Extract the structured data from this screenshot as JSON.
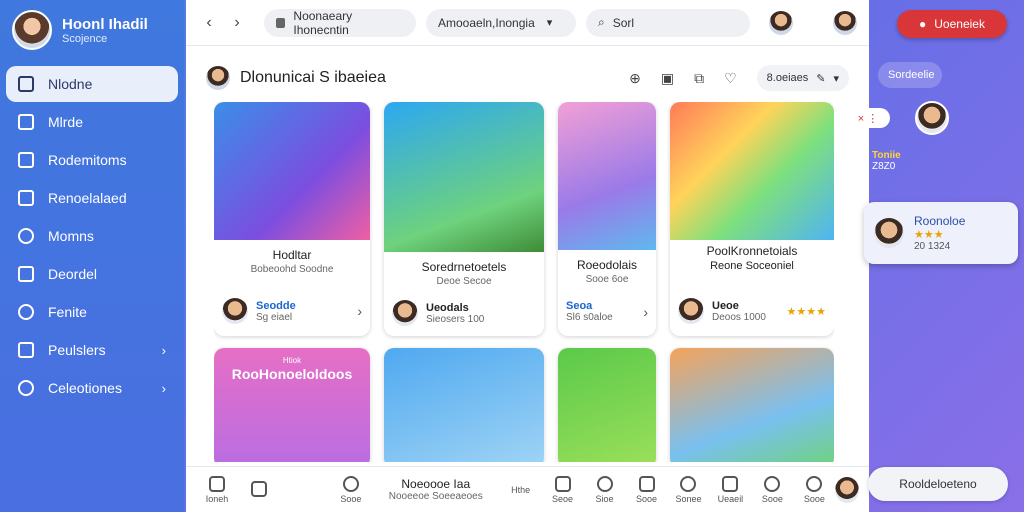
{
  "sidebar": {
    "profile": {
      "name": "Hoonl Ihadil",
      "subtitle": "Scojence"
    },
    "items": [
      {
        "label": "Nlodne",
        "icon": "square-icon",
        "active": true
      },
      {
        "label": "Mlrde",
        "icon": "list-icon"
      },
      {
        "label": "Rodemitoms",
        "icon": "bar-icon"
      },
      {
        "label": "Renoelalaed",
        "icon": "chart-icon"
      },
      {
        "label": "Momns",
        "icon": "shield-icon"
      },
      {
        "label": "Deordel",
        "icon": "calendar-icon"
      },
      {
        "label": "Fenite",
        "icon": "circle-icon"
      },
      {
        "label": "Peulslers",
        "icon": "folder-icon",
        "chevron": "›"
      },
      {
        "label": "Celeotiones",
        "icon": "gear-icon",
        "chevron": "›"
      }
    ]
  },
  "topbar": {
    "back": "‹",
    "forward": "›",
    "address": "Noonaeary Ihonecntin",
    "dropdown": "Amooaeln,Inongia",
    "search_placeholder": "Sorl"
  },
  "header": {
    "title": "Dlonunicai S ibaeiea",
    "sort_label": "8.oeiaes",
    "sort_caret": "▾"
  },
  "cards": [
    {
      "caption": "Hodltar",
      "sub": "Bobeoohd Soodne",
      "meta_name": "Seodde",
      "meta_sub": "Sg eiael",
      "end": "›"
    },
    {
      "caption": "Soredrnetoetels",
      "sub": "Deoe Secoe",
      "meta_name": "Ueodals",
      "meta_sub": "Sieosers 100"
    },
    {
      "caption": "Roeodolais",
      "sub": "Sooe 6oe",
      "meta_name": "Seoa",
      "meta_sub": "Sl6 s0aloe",
      "end": "›"
    },
    {
      "caption": "PoolKronnetoials",
      "sub": "Reone Soceoniel",
      "meta_name": "Ueoe",
      "meta_sub": "Deoos 1000",
      "stars": "★★★★"
    },
    {
      "banner": "RooHonoeloldoos",
      "badge": "Htiok"
    },
    {},
    {},
    {}
  ],
  "bottombar": {
    "items": [
      "Ioneh",
      "",
      "Sooe",
      "Seoe",
      "Sioe",
      "Sooe",
      "Sonee",
      "Seoe",
      "Ueaeil",
      "Sooe",
      "Sooe"
    ],
    "center_title": "Noeoooe Iaa",
    "center_sub": "Nooeeoe Soeeaeoes",
    "center_tag": "Hthe"
  },
  "right": {
    "action_label": "Uoeneiek",
    "tag_label": "Sordeelie",
    "notif": "× ⋮",
    "info_name": "Toniie",
    "info_sub": "Z8Z0",
    "card_title": "Roonoloe",
    "card_stars": "★★★",
    "card_sub": "20 1324",
    "bottom_label": "Rooldeloeteno"
  },
  "colors": {
    "accent": "#d9363a",
    "sidebar": "#3f78de",
    "link": "#1b66d1"
  }
}
